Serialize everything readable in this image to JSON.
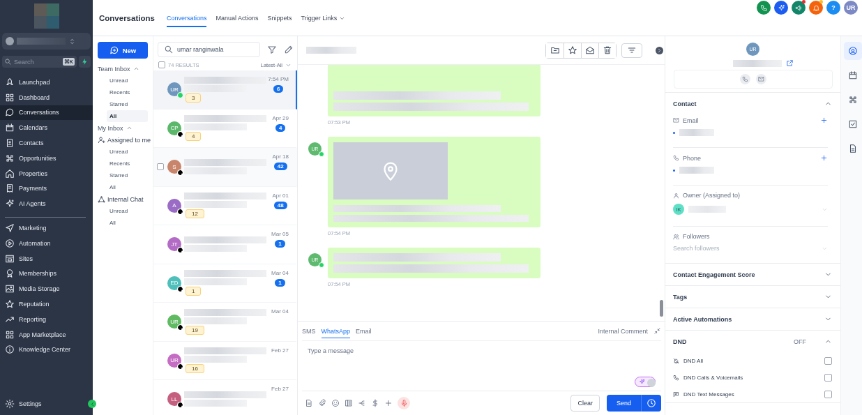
{
  "sidebar": {
    "search": {
      "placeholder": "Search",
      "shortcut": "⌘K"
    },
    "items": [
      {
        "label": "Launchpad",
        "selected": false
      },
      {
        "label": "Dashboard",
        "selected": false
      },
      {
        "label": "Conversations",
        "selected": true
      },
      {
        "label": "Calendars",
        "selected": false
      },
      {
        "label": "Contacts",
        "selected": false
      },
      {
        "label": "Opportunities",
        "selected": false
      },
      {
        "label": "Properties",
        "selected": false
      },
      {
        "label": "Payments",
        "selected": false
      },
      {
        "label": "AI Agents",
        "selected": false
      }
    ],
    "items_2": [
      {
        "label": "Marketing",
        "selected": false
      },
      {
        "label": "Automation",
        "selected": false
      },
      {
        "label": "Sites",
        "selected": false
      },
      {
        "label": "Memberships",
        "selected": false
      },
      {
        "label": "Media Storage",
        "selected": false
      },
      {
        "label": "Reputation",
        "selected": false
      },
      {
        "label": "Reporting",
        "selected": false
      },
      {
        "label": "App Marketplace",
        "selected": false
      },
      {
        "label": "Knowledge Center",
        "selected": false
      }
    ],
    "settings": "Settings"
  },
  "header": {
    "title": "Conversations",
    "tabs": [
      {
        "label": "Conversations",
        "selected": true,
        "dropdown": false
      },
      {
        "label": "Manual Actions",
        "selected": false,
        "dropdown": false
      },
      {
        "label": "Snippets",
        "selected": false,
        "dropdown": false
      },
      {
        "label": "Trigger Links",
        "selected": false,
        "dropdown": true
      }
    ],
    "actions": [
      {
        "kind": "phone",
        "color": "#12934f",
        "dot": false
      },
      {
        "kind": "sparkle",
        "color": "#1d5cf0",
        "dot": false
      },
      {
        "kind": "megaphone",
        "color": "#13866a",
        "dot": true
      },
      {
        "kind": "bell",
        "color": "#f4630c",
        "dot": true
      },
      {
        "kind": "help",
        "label": "?",
        "color": "#1b8df2",
        "dot": false
      },
      {
        "kind": "avatar",
        "label": "UR",
        "color": "#7c89c4",
        "dot": false
      }
    ]
  },
  "inbox": {
    "new_button": "New",
    "entries": [
      {
        "kind": "section",
        "label": "Team Inbox",
        "expanded": true
      },
      {
        "kind": "item",
        "label": "Unread",
        "selected": false
      },
      {
        "kind": "item",
        "label": "Recents",
        "selected": false
      },
      {
        "kind": "item",
        "label": "Starred",
        "selected": false
      },
      {
        "kind": "item",
        "label": "All",
        "selected": true
      },
      {
        "kind": "section",
        "label": "My Inbox",
        "expanded": true
      },
      {
        "kind": "group",
        "label": "Assigned to me"
      },
      {
        "kind": "item",
        "label": "Unread",
        "selected": false
      },
      {
        "kind": "item",
        "label": "Recents",
        "selected": false
      },
      {
        "kind": "item",
        "label": "Starred",
        "selected": false
      },
      {
        "kind": "item",
        "label": "All",
        "selected": false
      },
      {
        "kind": "chat_group",
        "label": "Internal Chat"
      },
      {
        "kind": "item",
        "label": "Unread",
        "selected": false
      },
      {
        "kind": "item",
        "label": "All",
        "selected": false
      }
    ]
  },
  "list": {
    "search_value": "umar ranginwala",
    "select_all": {
      "checked": false
    },
    "results": "74 RESULTS",
    "sort": "Latest-All",
    "conversations": [
      {
        "initials": "UR",
        "color": "#6f97bd",
        "kind": "whatsapp",
        "time": "7:54 PM",
        "unread": "6",
        "tag": "3",
        "selected": true,
        "hovered": false
      },
      {
        "initials": "CP",
        "color": "#5bb86a",
        "kind": "email",
        "time": "Apr 29",
        "unread": "4",
        "tag": "4",
        "selected": false,
        "hovered": false
      },
      {
        "initials": "S",
        "color": "#c8856b",
        "kind": "email",
        "time": "Apr 18",
        "unread": "42",
        "selected": false,
        "hovered": true
      },
      {
        "initials": "A",
        "color": "#9a6cc6",
        "kind": "email",
        "time": "Apr 01",
        "unread": "48",
        "tag": "12",
        "selected": false,
        "hovered": false
      },
      {
        "initials": "JT",
        "color": "#b36cc5",
        "kind": "email",
        "time": "Mar 05",
        "unread": "1",
        "selected": false,
        "hovered": false
      },
      {
        "initials": "ED",
        "color": "#4fbfbb",
        "kind": "email",
        "time": "Mar 04",
        "unread": "1",
        "tag": "1",
        "selected": false,
        "hovered": false
      },
      {
        "initials": "UR",
        "color": "#5fba62",
        "kind": "email",
        "time": "Mar 04",
        "tag": "19",
        "selected": false,
        "hovered": false
      },
      {
        "initials": "UR",
        "color": "#c56cc3",
        "kind": "email",
        "time": "Feb 27",
        "tag": "16",
        "selected": false,
        "hovered": false
      },
      {
        "initials": "LL",
        "color": "#c55f80",
        "kind": "email",
        "time": "Feb 27",
        "selected": false,
        "hovered": false
      }
    ]
  },
  "chat": {
    "messages": [
      {
        "kind": "text",
        "time": "07:53 PM"
      },
      {
        "kind": "location",
        "avatar": "UR",
        "time": "07:54 PM"
      },
      {
        "kind": "text",
        "avatar": "UR",
        "time": "07:54 PM"
      }
    ],
    "composer": {
      "tabs": [
        {
          "label": "SMS",
          "selected": false
        },
        {
          "label": "WhatsApp",
          "selected": true
        },
        {
          "label": "Email",
          "selected": false
        }
      ],
      "internal_comment": "Internal Comment",
      "placeholder": "Type a message",
      "ai_toggle": {
        "on": true
      },
      "clear": "Clear",
      "send": "Send"
    }
  },
  "details": {
    "avatar": "UR",
    "sections": [
      {
        "title": "Contact",
        "expanded": true,
        "fields": [
          {
            "kind": "email",
            "label": "Email"
          },
          {
            "kind": "phone",
            "label": "Phone"
          },
          {
            "kind": "owner",
            "label": "Owner (Assigned to)",
            "initials": "IK"
          },
          {
            "kind": "followers",
            "label": "Followers",
            "placeholder": "Search followers"
          }
        ]
      },
      {
        "title": "Contact Engagement Score",
        "expanded": false
      },
      {
        "title": "Tags",
        "expanded": false
      },
      {
        "title": "Active Automations",
        "expanded": false
      },
      {
        "title": "DND",
        "status": "OFF",
        "expanded": true,
        "options": [
          {
            "kind": "all",
            "label": "DND All",
            "checked": false
          },
          {
            "kind": "calls",
            "label": "DND Calls & Voicemails",
            "checked": false
          },
          {
            "kind": "texts",
            "label": "DND Text Messages",
            "checked": false
          }
        ]
      }
    ]
  },
  "rail": [
    {
      "kind": "contact",
      "selected": true
    },
    {
      "kind": "calendar",
      "selected": false
    },
    {
      "kind": "nodes",
      "selected": false
    },
    {
      "kind": "task",
      "selected": false
    },
    {
      "kind": "document",
      "selected": false
    }
  ]
}
